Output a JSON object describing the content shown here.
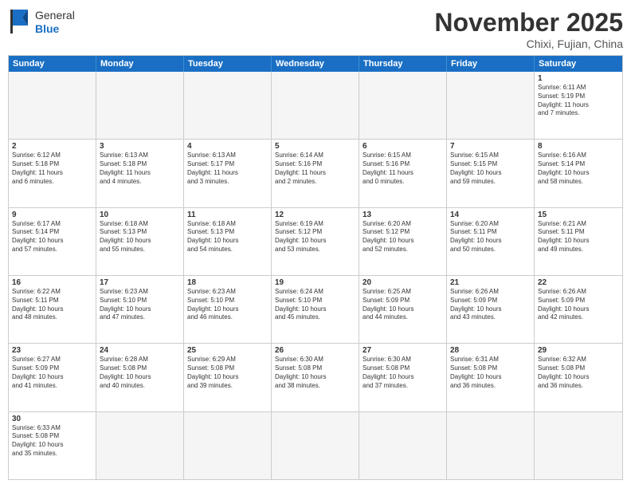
{
  "header": {
    "logo_general": "General",
    "logo_blue": "Blue",
    "month_title": "November 2025",
    "location": "Chixi, Fujian, China"
  },
  "day_headers": [
    "Sunday",
    "Monday",
    "Tuesday",
    "Wednesday",
    "Thursday",
    "Friday",
    "Saturday"
  ],
  "weeks": [
    [
      {
        "num": "",
        "info": "",
        "empty": true
      },
      {
        "num": "",
        "info": "",
        "empty": true
      },
      {
        "num": "",
        "info": "",
        "empty": true
      },
      {
        "num": "",
        "info": "",
        "empty": true
      },
      {
        "num": "",
        "info": "",
        "empty": true
      },
      {
        "num": "",
        "info": "",
        "empty": true
      },
      {
        "num": "1",
        "info": "Sunrise: 6:11 AM\nSunset: 5:19 PM\nDaylight: 11 hours\nand 7 minutes."
      }
    ],
    [
      {
        "num": "2",
        "info": "Sunrise: 6:12 AM\nSunset: 5:18 PM\nDaylight: 11 hours\nand 6 minutes."
      },
      {
        "num": "3",
        "info": "Sunrise: 6:13 AM\nSunset: 5:18 PM\nDaylight: 11 hours\nand 4 minutes."
      },
      {
        "num": "4",
        "info": "Sunrise: 6:13 AM\nSunset: 5:17 PM\nDaylight: 11 hours\nand 3 minutes."
      },
      {
        "num": "5",
        "info": "Sunrise: 6:14 AM\nSunset: 5:16 PM\nDaylight: 11 hours\nand 2 minutes."
      },
      {
        "num": "6",
        "info": "Sunrise: 6:15 AM\nSunset: 5:16 PM\nDaylight: 11 hours\nand 0 minutes."
      },
      {
        "num": "7",
        "info": "Sunrise: 6:15 AM\nSunset: 5:15 PM\nDaylight: 10 hours\nand 59 minutes."
      },
      {
        "num": "8",
        "info": "Sunrise: 6:16 AM\nSunset: 5:14 PM\nDaylight: 10 hours\nand 58 minutes."
      }
    ],
    [
      {
        "num": "9",
        "info": "Sunrise: 6:17 AM\nSunset: 5:14 PM\nDaylight: 10 hours\nand 57 minutes."
      },
      {
        "num": "10",
        "info": "Sunrise: 6:18 AM\nSunset: 5:13 PM\nDaylight: 10 hours\nand 55 minutes."
      },
      {
        "num": "11",
        "info": "Sunrise: 6:18 AM\nSunset: 5:13 PM\nDaylight: 10 hours\nand 54 minutes."
      },
      {
        "num": "12",
        "info": "Sunrise: 6:19 AM\nSunset: 5:12 PM\nDaylight: 10 hours\nand 53 minutes."
      },
      {
        "num": "13",
        "info": "Sunrise: 6:20 AM\nSunset: 5:12 PM\nDaylight: 10 hours\nand 52 minutes."
      },
      {
        "num": "14",
        "info": "Sunrise: 6:20 AM\nSunset: 5:11 PM\nDaylight: 10 hours\nand 50 minutes."
      },
      {
        "num": "15",
        "info": "Sunrise: 6:21 AM\nSunset: 5:11 PM\nDaylight: 10 hours\nand 49 minutes."
      }
    ],
    [
      {
        "num": "16",
        "info": "Sunrise: 6:22 AM\nSunset: 5:11 PM\nDaylight: 10 hours\nand 48 minutes."
      },
      {
        "num": "17",
        "info": "Sunrise: 6:23 AM\nSunset: 5:10 PM\nDaylight: 10 hours\nand 47 minutes."
      },
      {
        "num": "18",
        "info": "Sunrise: 6:23 AM\nSunset: 5:10 PM\nDaylight: 10 hours\nand 46 minutes."
      },
      {
        "num": "19",
        "info": "Sunrise: 6:24 AM\nSunset: 5:10 PM\nDaylight: 10 hours\nand 45 minutes."
      },
      {
        "num": "20",
        "info": "Sunrise: 6:25 AM\nSunset: 5:09 PM\nDaylight: 10 hours\nand 44 minutes."
      },
      {
        "num": "21",
        "info": "Sunrise: 6:26 AM\nSunset: 5:09 PM\nDaylight: 10 hours\nand 43 minutes."
      },
      {
        "num": "22",
        "info": "Sunrise: 6:26 AM\nSunset: 5:09 PM\nDaylight: 10 hours\nand 42 minutes."
      }
    ],
    [
      {
        "num": "23",
        "info": "Sunrise: 6:27 AM\nSunset: 5:09 PM\nDaylight: 10 hours\nand 41 minutes."
      },
      {
        "num": "24",
        "info": "Sunrise: 6:28 AM\nSunset: 5:08 PM\nDaylight: 10 hours\nand 40 minutes."
      },
      {
        "num": "25",
        "info": "Sunrise: 6:29 AM\nSunset: 5:08 PM\nDaylight: 10 hours\nand 39 minutes."
      },
      {
        "num": "26",
        "info": "Sunrise: 6:30 AM\nSunset: 5:08 PM\nDaylight: 10 hours\nand 38 minutes."
      },
      {
        "num": "27",
        "info": "Sunrise: 6:30 AM\nSunset: 5:08 PM\nDaylight: 10 hours\nand 37 minutes."
      },
      {
        "num": "28",
        "info": "Sunrise: 6:31 AM\nSunset: 5:08 PM\nDaylight: 10 hours\nand 36 minutes."
      },
      {
        "num": "29",
        "info": "Sunrise: 6:32 AM\nSunset: 5:08 PM\nDaylight: 10 hours\nand 36 minutes."
      }
    ],
    [
      {
        "num": "30",
        "info": "Sunrise: 6:33 AM\nSunset: 5:08 PM\nDaylight: 10 hours\nand 35 minutes."
      },
      {
        "num": "",
        "info": "",
        "empty": true
      },
      {
        "num": "",
        "info": "",
        "empty": true
      },
      {
        "num": "",
        "info": "",
        "empty": true
      },
      {
        "num": "",
        "info": "",
        "empty": true
      },
      {
        "num": "",
        "info": "",
        "empty": true
      },
      {
        "num": "",
        "info": "",
        "empty": true
      }
    ]
  ]
}
